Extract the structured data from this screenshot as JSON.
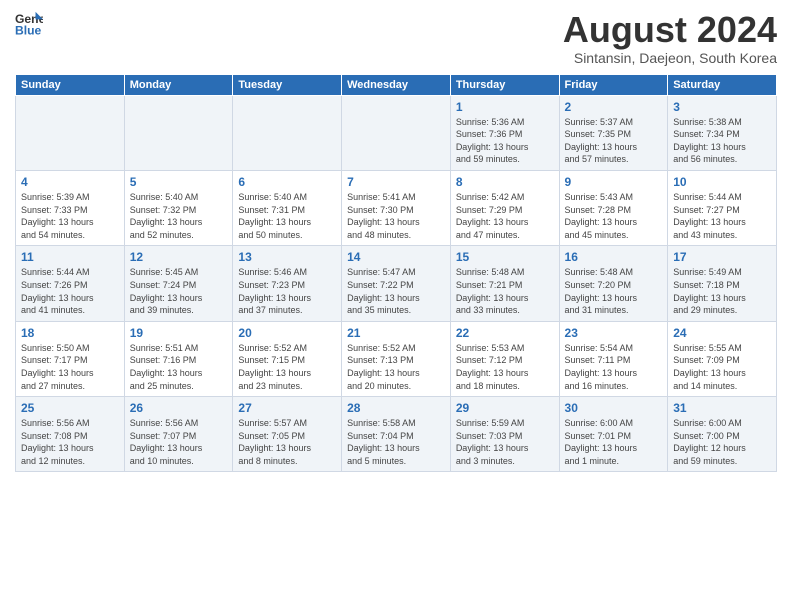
{
  "header": {
    "logo_line1": "General",
    "logo_line2": "Blue",
    "month_title": "August 2024",
    "subtitle": "Sintansin, Daejeon, South Korea"
  },
  "weekdays": [
    "Sunday",
    "Monday",
    "Tuesday",
    "Wednesday",
    "Thursday",
    "Friday",
    "Saturday"
  ],
  "weeks": [
    [
      {
        "day": "",
        "info": ""
      },
      {
        "day": "",
        "info": ""
      },
      {
        "day": "",
        "info": ""
      },
      {
        "day": "",
        "info": ""
      },
      {
        "day": "1",
        "info": "Sunrise: 5:36 AM\nSunset: 7:36 PM\nDaylight: 13 hours\nand 59 minutes."
      },
      {
        "day": "2",
        "info": "Sunrise: 5:37 AM\nSunset: 7:35 PM\nDaylight: 13 hours\nand 57 minutes."
      },
      {
        "day": "3",
        "info": "Sunrise: 5:38 AM\nSunset: 7:34 PM\nDaylight: 13 hours\nand 56 minutes."
      }
    ],
    [
      {
        "day": "4",
        "info": "Sunrise: 5:39 AM\nSunset: 7:33 PM\nDaylight: 13 hours\nand 54 minutes."
      },
      {
        "day": "5",
        "info": "Sunrise: 5:40 AM\nSunset: 7:32 PM\nDaylight: 13 hours\nand 52 minutes."
      },
      {
        "day": "6",
        "info": "Sunrise: 5:40 AM\nSunset: 7:31 PM\nDaylight: 13 hours\nand 50 minutes."
      },
      {
        "day": "7",
        "info": "Sunrise: 5:41 AM\nSunset: 7:30 PM\nDaylight: 13 hours\nand 48 minutes."
      },
      {
        "day": "8",
        "info": "Sunrise: 5:42 AM\nSunset: 7:29 PM\nDaylight: 13 hours\nand 47 minutes."
      },
      {
        "day": "9",
        "info": "Sunrise: 5:43 AM\nSunset: 7:28 PM\nDaylight: 13 hours\nand 45 minutes."
      },
      {
        "day": "10",
        "info": "Sunrise: 5:44 AM\nSunset: 7:27 PM\nDaylight: 13 hours\nand 43 minutes."
      }
    ],
    [
      {
        "day": "11",
        "info": "Sunrise: 5:44 AM\nSunset: 7:26 PM\nDaylight: 13 hours\nand 41 minutes."
      },
      {
        "day": "12",
        "info": "Sunrise: 5:45 AM\nSunset: 7:24 PM\nDaylight: 13 hours\nand 39 minutes."
      },
      {
        "day": "13",
        "info": "Sunrise: 5:46 AM\nSunset: 7:23 PM\nDaylight: 13 hours\nand 37 minutes."
      },
      {
        "day": "14",
        "info": "Sunrise: 5:47 AM\nSunset: 7:22 PM\nDaylight: 13 hours\nand 35 minutes."
      },
      {
        "day": "15",
        "info": "Sunrise: 5:48 AM\nSunset: 7:21 PM\nDaylight: 13 hours\nand 33 minutes."
      },
      {
        "day": "16",
        "info": "Sunrise: 5:48 AM\nSunset: 7:20 PM\nDaylight: 13 hours\nand 31 minutes."
      },
      {
        "day": "17",
        "info": "Sunrise: 5:49 AM\nSunset: 7:18 PM\nDaylight: 13 hours\nand 29 minutes."
      }
    ],
    [
      {
        "day": "18",
        "info": "Sunrise: 5:50 AM\nSunset: 7:17 PM\nDaylight: 13 hours\nand 27 minutes."
      },
      {
        "day": "19",
        "info": "Sunrise: 5:51 AM\nSunset: 7:16 PM\nDaylight: 13 hours\nand 25 minutes."
      },
      {
        "day": "20",
        "info": "Sunrise: 5:52 AM\nSunset: 7:15 PM\nDaylight: 13 hours\nand 23 minutes."
      },
      {
        "day": "21",
        "info": "Sunrise: 5:52 AM\nSunset: 7:13 PM\nDaylight: 13 hours\nand 20 minutes."
      },
      {
        "day": "22",
        "info": "Sunrise: 5:53 AM\nSunset: 7:12 PM\nDaylight: 13 hours\nand 18 minutes."
      },
      {
        "day": "23",
        "info": "Sunrise: 5:54 AM\nSunset: 7:11 PM\nDaylight: 13 hours\nand 16 minutes."
      },
      {
        "day": "24",
        "info": "Sunrise: 5:55 AM\nSunset: 7:09 PM\nDaylight: 13 hours\nand 14 minutes."
      }
    ],
    [
      {
        "day": "25",
        "info": "Sunrise: 5:56 AM\nSunset: 7:08 PM\nDaylight: 13 hours\nand 12 minutes."
      },
      {
        "day": "26",
        "info": "Sunrise: 5:56 AM\nSunset: 7:07 PM\nDaylight: 13 hours\nand 10 minutes."
      },
      {
        "day": "27",
        "info": "Sunrise: 5:57 AM\nSunset: 7:05 PM\nDaylight: 13 hours\nand 8 minutes."
      },
      {
        "day": "28",
        "info": "Sunrise: 5:58 AM\nSunset: 7:04 PM\nDaylight: 13 hours\nand 5 minutes."
      },
      {
        "day": "29",
        "info": "Sunrise: 5:59 AM\nSunset: 7:03 PM\nDaylight: 13 hours\nand 3 minutes."
      },
      {
        "day": "30",
        "info": "Sunrise: 6:00 AM\nSunset: 7:01 PM\nDaylight: 13 hours\nand 1 minute."
      },
      {
        "day": "31",
        "info": "Sunrise: 6:00 AM\nSunset: 7:00 PM\nDaylight: 12 hours\nand 59 minutes."
      }
    ]
  ]
}
